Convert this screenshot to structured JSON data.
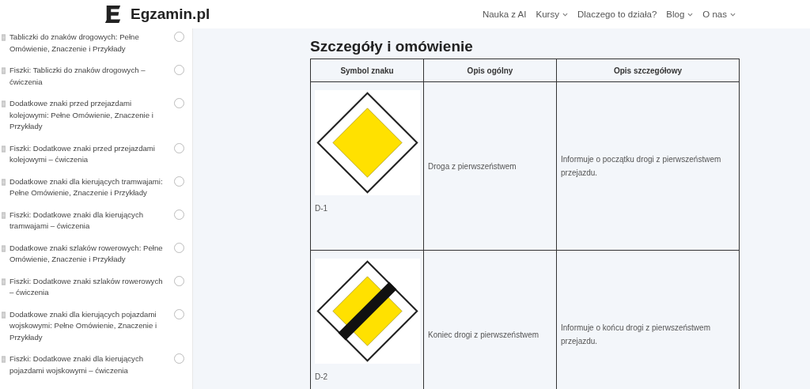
{
  "header": {
    "logo_text": "Egzamin.pl",
    "nav": [
      {
        "label": "Nauka z AI",
        "dropdown": false
      },
      {
        "label": "Kursy",
        "dropdown": true
      },
      {
        "label": "Dlaczego to działa?",
        "dropdown": false
      },
      {
        "label": "Blog",
        "dropdown": true
      },
      {
        "label": "O nas",
        "dropdown": true
      }
    ]
  },
  "sidebar": {
    "items": [
      {
        "title": "Tabliczki do znaków drogowych: Pełne Omówienie, Znaczenie i Przykłady",
        "completed": false
      },
      {
        "title": "Fiszki: Tabliczki do znaków drogowych – ćwiczenia",
        "completed": false
      },
      {
        "title": "Dodatkowe znaki przed przejazdami kolejowymi: Pełne Omówienie, Znaczenie i Przykłady",
        "completed": false
      },
      {
        "title": "Fiszki: Dodatkowe znaki przed przejazdami kolejowymi – ćwiczenia",
        "completed": false
      },
      {
        "title": "Dodatkowe znaki dla kierujących tramwajami: Pełne Omówienie, Znaczenie i Przykłady",
        "completed": false
      },
      {
        "title": "Fiszki: Dodatkowe znaki dla kierujących tramwajami – ćwiczenia",
        "completed": false
      },
      {
        "title": "Dodatkowe znaki szlaków rowerowych: Pełne Omówienie, Znaczenie i Przykłady",
        "completed": false
      },
      {
        "title": "Fiszki: Dodatkowe znaki szlaków rowerowych – ćwiczenia",
        "completed": false
      },
      {
        "title": "Dodatkowe znaki dla kierujących pojazdami wojskowymi: Pełne Omówienie, Znaczenie i Przykłady",
        "completed": false
      },
      {
        "title": "Fiszki: Dodatkowe znaki dla kierujących pojazdami wojskowymi – ćwiczenia",
        "completed": false
      }
    ]
  },
  "content": {
    "heading": "Szczegóły i omówienie",
    "table": {
      "columns": [
        "Symbol znaku",
        "Opis ogólny",
        "Opis szczegółowy"
      ],
      "rows": [
        {
          "sign": {
            "kind": "priority_road",
            "code": "D-1"
          },
          "general": "Droga z pierwszeństwem",
          "detail": "Informuje o początku drogi z pierwszeństwem przejazdu."
        },
        {
          "sign": {
            "kind": "priority_road_end",
            "code": "D-2"
          },
          "general": "Koniec drogi z pierwszeństwem",
          "detail": "Informuje o końcu drogi z pierwszeństwem przejazdu."
        }
      ]
    }
  }
}
